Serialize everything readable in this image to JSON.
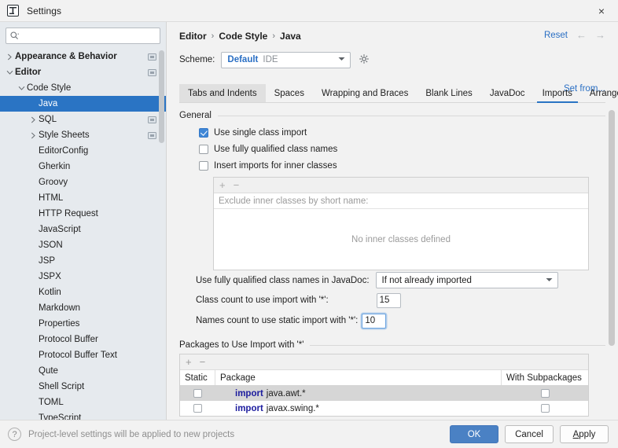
{
  "window": {
    "title": "Settings",
    "app_icon": "intellij-logo-icon",
    "close_label": "×"
  },
  "sidebar": {
    "search": {
      "placeholder": "",
      "value": "",
      "icon": "search-icon"
    },
    "items": [
      {
        "label": "Appearance & Behavior",
        "indent": 0,
        "twisty": "collapsed",
        "bold": true,
        "badge": true,
        "selected": false
      },
      {
        "label": "Editor",
        "indent": 0,
        "twisty": "expanded",
        "bold": true,
        "badge": true,
        "selected": false
      },
      {
        "label": "Code Style",
        "indent": 1,
        "twisty": "expanded",
        "bold": false,
        "badge": false,
        "selected": false
      },
      {
        "label": "Java",
        "indent": 2,
        "twisty": "none",
        "bold": false,
        "badge": false,
        "selected": true
      },
      {
        "label": "SQL",
        "indent": 2,
        "twisty": "collapsed",
        "bold": false,
        "badge": true,
        "selected": false
      },
      {
        "label": "Style Sheets",
        "indent": 2,
        "twisty": "collapsed",
        "bold": false,
        "badge": true,
        "selected": false
      },
      {
        "label": "EditorConfig",
        "indent": 2,
        "twisty": "none",
        "bold": false,
        "badge": false,
        "selected": false
      },
      {
        "label": "Gherkin",
        "indent": 2,
        "twisty": "none",
        "bold": false,
        "badge": false,
        "selected": false
      },
      {
        "label": "Groovy",
        "indent": 2,
        "twisty": "none",
        "bold": false,
        "badge": false,
        "selected": false
      },
      {
        "label": "HTML",
        "indent": 2,
        "twisty": "none",
        "bold": false,
        "badge": false,
        "selected": false
      },
      {
        "label": "HTTP Request",
        "indent": 2,
        "twisty": "none",
        "bold": false,
        "badge": false,
        "selected": false
      },
      {
        "label": "JavaScript",
        "indent": 2,
        "twisty": "none",
        "bold": false,
        "badge": false,
        "selected": false
      },
      {
        "label": "JSON",
        "indent": 2,
        "twisty": "none",
        "bold": false,
        "badge": false,
        "selected": false
      },
      {
        "label": "JSP",
        "indent": 2,
        "twisty": "none",
        "bold": false,
        "badge": false,
        "selected": false
      },
      {
        "label": "JSPX",
        "indent": 2,
        "twisty": "none",
        "bold": false,
        "badge": false,
        "selected": false
      },
      {
        "label": "Kotlin",
        "indent": 2,
        "twisty": "none",
        "bold": false,
        "badge": false,
        "selected": false
      },
      {
        "label": "Markdown",
        "indent": 2,
        "twisty": "none",
        "bold": false,
        "badge": false,
        "selected": false
      },
      {
        "label": "Properties",
        "indent": 2,
        "twisty": "none",
        "bold": false,
        "badge": false,
        "selected": false
      },
      {
        "label": "Protocol Buffer",
        "indent": 2,
        "twisty": "none",
        "bold": false,
        "badge": false,
        "selected": false
      },
      {
        "label": "Protocol Buffer Text",
        "indent": 2,
        "twisty": "none",
        "bold": false,
        "badge": false,
        "selected": false
      },
      {
        "label": "Qute",
        "indent": 2,
        "twisty": "none",
        "bold": false,
        "badge": false,
        "selected": false
      },
      {
        "label": "Shell Script",
        "indent": 2,
        "twisty": "none",
        "bold": false,
        "badge": false,
        "selected": false
      },
      {
        "label": "TOML",
        "indent": 2,
        "twisty": "none",
        "bold": false,
        "badge": false,
        "selected": false
      },
      {
        "label": "TypeScript",
        "indent": 2,
        "twisty": "none",
        "bold": false,
        "badge": false,
        "selected": false
      }
    ]
  },
  "header": {
    "breadcrumb": [
      "Editor",
      "Code Style",
      "Java"
    ],
    "separator": "›",
    "reset_label": "Reset",
    "back_icon": "arrow-left-icon",
    "forward_icon": "arrow-right-icon",
    "back_glyph": "←",
    "forward_glyph": "→"
  },
  "scheme": {
    "label": "Scheme:",
    "value": "Default",
    "scope": "IDE",
    "dropdown_icon": "chevron-down-icon",
    "gear_icon": "gear-icon",
    "set_from_label": "Set from..."
  },
  "tabs": [
    {
      "label": "Tabs and Indents",
      "state": "hover"
    },
    {
      "label": "Spaces",
      "state": "normal"
    },
    {
      "label": "Wrapping and Braces",
      "state": "normal"
    },
    {
      "label": "Blank Lines",
      "state": "normal"
    },
    {
      "label": "JavaDoc",
      "state": "normal"
    },
    {
      "label": "Imports",
      "state": "active"
    },
    {
      "label": "Arrangement",
      "state": "normal"
    }
  ],
  "general": {
    "title": "General",
    "checkboxes": [
      {
        "label": "Use single class import",
        "checked": true
      },
      {
        "label": "Use fully qualified class names",
        "checked": false
      },
      {
        "label": "Insert imports for inner classes",
        "checked": false
      }
    ]
  },
  "inner_classes_panel": {
    "add_icon": "plus-icon",
    "remove_icon": "minus-icon",
    "add_glyph": "+",
    "remove_glyph": "−",
    "column_header": "Exclude inner classes by short name:",
    "empty_text": "No inner classes defined"
  },
  "javadoc": {
    "label": "Use fully qualified class names in JavaDoc:",
    "value": "If not already imported",
    "dropdown_icon": "chevron-down-icon"
  },
  "counts": {
    "class_count_label": "Class count to use import with '*':",
    "class_count_value": "15",
    "names_count_label": "Names count to use static import with '*':",
    "names_count_value": "10"
  },
  "packages": {
    "title": "Packages to Use Import with '*'",
    "add_icon": "plus-icon",
    "remove_icon": "minus-icon",
    "add_glyph": "+",
    "remove_glyph": "−",
    "columns": [
      "Static",
      "Package",
      "With Subpackages"
    ],
    "rows": [
      {
        "static": false,
        "keyword": "import",
        "package": "java.awt.*",
        "with_subpackages": false,
        "selected": true
      },
      {
        "static": false,
        "keyword": "import",
        "package": "javax.swing.*",
        "with_subpackages": false,
        "selected": false
      }
    ]
  },
  "footer": {
    "help_icon": "question-mark-icon",
    "help_glyph": "?",
    "note": "Project-level settings will be applied to new projects",
    "ok_label": "OK",
    "cancel_label": "Cancel",
    "apply_mnemonic": "A",
    "apply_rest": "pply"
  },
  "colors": {
    "accent": "#2a74c4",
    "selection": "#2a74c4",
    "primary_button": "#4a81c4",
    "link": "#2a6fc4",
    "keyword": "#1b1b9e",
    "sidebar_bg": "#e6eaee",
    "panel_bg": "#f2f2f2"
  }
}
